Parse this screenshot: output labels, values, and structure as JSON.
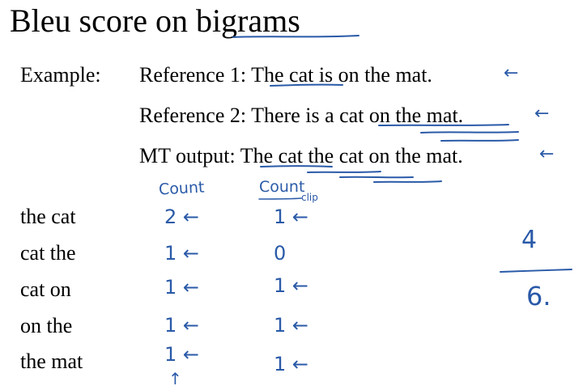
{
  "title": "Bleu score on bigrams",
  "example_label": "Example:",
  "references": [
    "Reference 1: The cat is on the mat.",
    "Reference 2: There is a cat on the mat."
  ],
  "mt_output": "MT output: The cat the cat on the mat.",
  "columns": {
    "count": "Count",
    "count_clip": "Count",
    "count_clip_sub": "clip"
  },
  "rows": [
    {
      "bigram": "the cat",
      "count": "2 ←",
      "count_clip": "1 ←"
    },
    {
      "bigram": "cat the",
      "count": "1 ←",
      "count_clip": "0"
    },
    {
      "bigram": "cat on",
      "count": "1 ←",
      "count_clip": "1 ←"
    },
    {
      "bigram": "on the",
      "count": "1 ←",
      "count_clip": "1 ←"
    },
    {
      "bigram": "the mat",
      "count": "1 ←",
      "count_clip": "1 ←"
    }
  ],
  "annotations": {
    "side_arrow": "←",
    "up_arrow": "↑",
    "fraction_numerator": "4",
    "fraction_denominator": "6."
  },
  "colors": {
    "text": "#000000",
    "ink": "#2a5aa8",
    "background": "#ffffff"
  }
}
